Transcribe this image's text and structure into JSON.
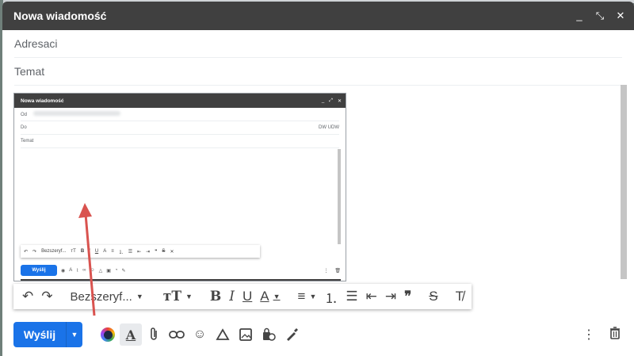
{
  "window": {
    "title": "Nowa wiadomość",
    "minimize": "_",
    "fullscreen": "⤡",
    "close": "✕"
  },
  "fields": {
    "recipients_placeholder": "Adresaci",
    "subject_placeholder": "Temat"
  },
  "embedded_screenshot": {
    "title": "Nowa wiadomość",
    "controls": [
      "_",
      "⤢",
      "✕"
    ],
    "from_label": "Od",
    "to_label": "Do",
    "cc_bcc": "DW UDW",
    "subject_label": "Temat",
    "font_name": "Bezszeryf...",
    "send_label": "Wyślij"
  },
  "format_toolbar": {
    "undo": "↶",
    "redo": "↷",
    "font_name": "Bezszeryf...",
    "font_size": "тT",
    "bold": "B",
    "italic": "I",
    "underline": "U",
    "text_color": "A",
    "align": "≡",
    "numbered_list": "⒈",
    "bulleted_list": "☰",
    "indent_less": "⇤",
    "indent_more": "⇥",
    "quote": "❞",
    "strikethrough": "S",
    "clear_formatting": "T̸"
  },
  "bottom_bar": {
    "send_label": "Wyślij",
    "icons": [
      "color-picker",
      "text-color",
      "attach",
      "link",
      "emoji",
      "drive",
      "photo",
      "confidential",
      "signature"
    ],
    "more": "⋮",
    "delete": "🗑"
  },
  "accent_colors": {
    "send": "#1a73e8",
    "title_bar": "#404040",
    "arrow": "#d9534f"
  }
}
